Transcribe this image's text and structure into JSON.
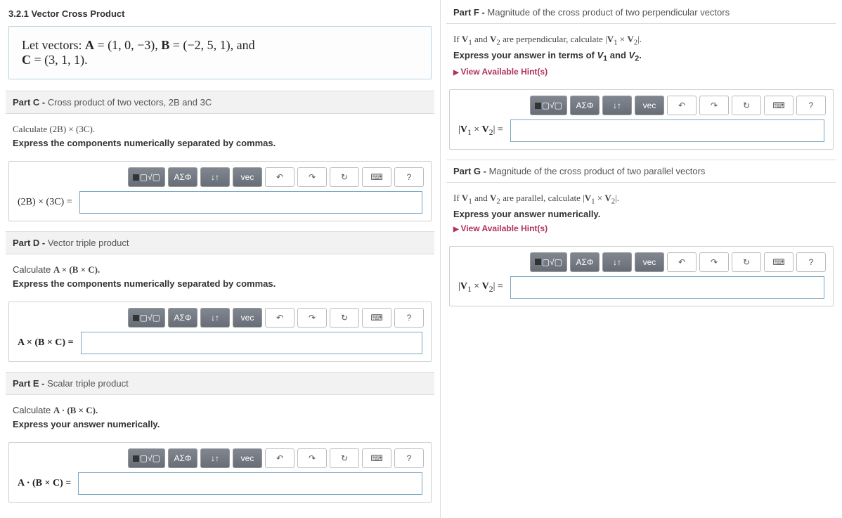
{
  "section_title": "3.2.1 Vector Cross Product",
  "problem": {
    "line1_prefix": "Let vectors: ",
    "A_label": "A",
    "A_val": " = (1, 0, −3), ",
    "B_label": "B",
    "B_val": " = (−2, 5, 1)",
    "line1_suffix": ", and",
    "C_label": "C",
    "C_val": " = (3, 1, 1)."
  },
  "toolbar": {
    "templates": "▢√▢",
    "greek": "ΑΣΦ",
    "subsup": "↓↑",
    "vec": "vec",
    "undo": "↶",
    "redo": "↷",
    "reset": "↻",
    "keyboard": "⌨",
    "help": "?"
  },
  "parts": {
    "C": {
      "header_bold": "Part C - ",
      "header_rest": "Cross product of two vectors, 2B and 3C",
      "calc": "Calculate (2B) × (3C).",
      "instr": "Express the components numerically separated by commas.",
      "eq_label": "(2B) × (3C) ="
    },
    "D": {
      "header_bold": "Part D - ",
      "header_rest": "Vector triple product",
      "calc_prefix": "Calculate ",
      "calc_math": "A × (B × C).",
      "instr": "Express the components numerically separated by commas.",
      "eq_label": "A × (B × C) ="
    },
    "E": {
      "header_bold": "Part E - ",
      "header_rest": "Scalar triple product",
      "calc_prefix": "Calculate ",
      "calc_math": "A · (B × C).",
      "instr": "Express your answer numerically.",
      "eq_label": "A · (B × C) ="
    },
    "F": {
      "header_bold": "Part F - ",
      "header_rest": "Magnitude of the cross product of two perpendicular vectors",
      "cond_html": "If <b>V</b><sub>1</sub> and <b>V</b><sub>2</sub> are perpendicular, calculate |<b>V</b><sub>1</sub> × <b>V</b><sub>2</sub>|.",
      "instr_html": "Express your answer in terms of <i>V</i><sub>1</sub> and <i>V</i><sub>2</sub>.",
      "hints": "View Available Hint(s)",
      "eq_label_html": "|<b>V</b><sub>1</sub> × <b>V</b><sub>2</sub>| ="
    },
    "G": {
      "header_bold": "Part G - ",
      "header_rest": "Magnitude of the cross product of two parallel vectors",
      "cond_html": "If <b>V</b><sub>1</sub> and <b>V</b><sub>2</sub> are parallel, calculate |<b>V</b><sub>1</sub> × <b>V</b><sub>2</sub>|.",
      "instr": "Express your answer numerically.",
      "hints": "View Available Hint(s)",
      "eq_label_html": "|<b>V</b><sub>1</sub> × <b>V</b><sub>2</sub>| ="
    }
  }
}
